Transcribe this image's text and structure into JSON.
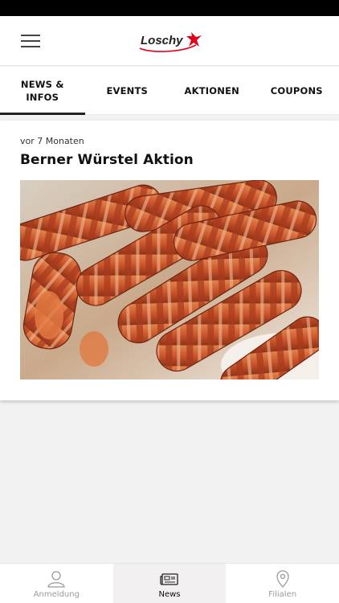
{
  "brand": {
    "logo_text": "Loschy",
    "accent_color": "#e3001b"
  },
  "header": {
    "menu_icon": "hamburger-menu-icon"
  },
  "tabs": [
    {
      "label": "NEWS &\nINFOS",
      "active": true
    },
    {
      "label": "EVENTS",
      "active": false
    },
    {
      "label": "AKTIONEN",
      "active": false
    },
    {
      "label": "COUPONS",
      "active": false
    }
  ],
  "news": [
    {
      "time": "vor 7 Monaten",
      "title": "Berner Würstel Aktion",
      "image": "bacon-wrapped-sausages-photo"
    }
  ],
  "bottom_nav": [
    {
      "label": "Anmeldung",
      "icon": "user-icon",
      "active": false
    },
    {
      "label": "News",
      "icon": "newspaper-icon",
      "active": true
    },
    {
      "label": "Filialen",
      "icon": "location-pin-icon",
      "active": false
    }
  ]
}
